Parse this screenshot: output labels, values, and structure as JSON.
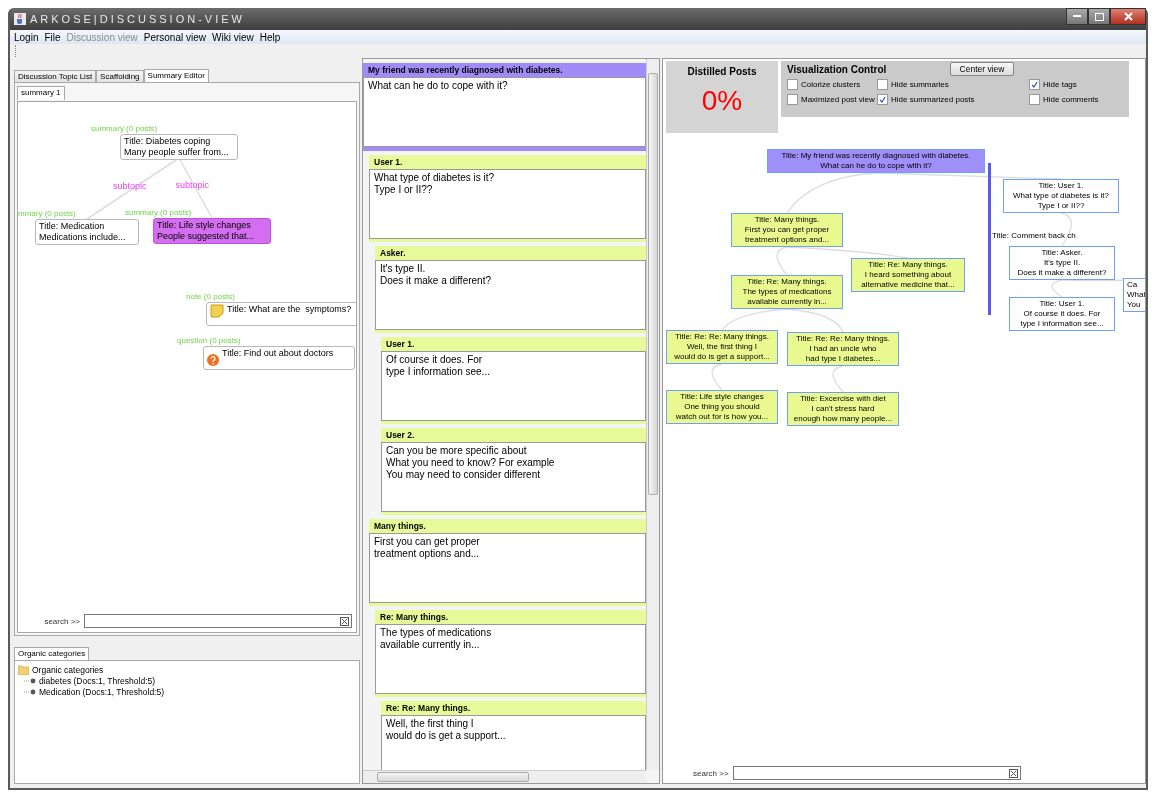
{
  "window": {
    "title": "ARKOSE|DISCUSSION-VIEW"
  },
  "menu": [
    {
      "label": "Login",
      "disabled": false
    },
    {
      "label": "File",
      "disabled": false
    },
    {
      "label": "Discussion view",
      "disabled": true
    },
    {
      "label": "Personal view",
      "disabled": false
    },
    {
      "label": "Wiki view",
      "disabled": false
    },
    {
      "label": "Help",
      "disabled": false
    }
  ],
  "left_tabs": [
    {
      "label": "Discussion Topic List",
      "selected": false
    },
    {
      "label": "Scaffolding",
      "selected": false
    },
    {
      "label": "Summary Editor",
      "selected": true
    }
  ],
  "summary_tabs": [
    {
      "label": "summary 1",
      "selected": true
    }
  ],
  "summary_map": {
    "nodes": [
      {
        "tag": "summary (0 posts)",
        "text": "Title: Diabetes coping\nMany people suffer from...",
        "selected": false,
        "children": [
          {
            "relation": "subtopic",
            "tag": "mmary (0 posts)",
            "text": "Title: Medication\nMedications include...",
            "selected": false
          },
          {
            "relation": "subtopic",
            "tag": "summary (0 posts)",
            "text": "Title: Life style changes\nPeople suggested that...",
            "selected": true
          }
        ]
      },
      {
        "kind": "note",
        "tag": "note (0 posts)",
        "text": "Title: What are the  symptoms?",
        "selected": false
      },
      {
        "kind": "question",
        "tag": "question (0 posts)",
        "text": "Title: Find out about doctors",
        "selected": false
      }
    ]
  },
  "summary_search": {
    "label": "search >>"
  },
  "categories": {
    "tab": "Organic categories",
    "root": "Organic categories",
    "children": [
      {
        "label": "diabetes (Docs:1, Threshold:5)"
      },
      {
        "label": "Medication (Docs:1, Threshold:5)"
      }
    ]
  },
  "thread": {
    "posts": [
      {
        "kind": "root",
        "title": "My friend was recently diagnosed with diabetes.",
        "body": "What can he do to cope with it?",
        "children": [
          {
            "kind": "reply",
            "title": "User 1.",
            "body": "What type of diabetes is it?\nType I or II??",
            "children": [
              {
                "kind": "reply",
                "title": "Asker.",
                "body": "It's type II.\nDoes it make a different?",
                "children": [
                  {
                    "kind": "reply",
                    "title": "User 1.",
                    "body": "Of course it does. For\ntype I information see..."
                  },
                  {
                    "kind": "reply",
                    "title": "User 2.",
                    "body": "Can you be more specific about\nWhat you need to know? For example\nYou may need to consider different"
                  }
                ]
              }
            ]
          },
          {
            "kind": "reply",
            "title": "Many things.",
            "body": "First you can get proper\ntreatment options and...",
            "children": [
              {
                "kind": "reply",
                "title": "Re: Many things.",
                "body": "The types of medications\navailable currently in...",
                "children": [
                  {
                    "kind": "reply",
                    "title": "Re: Re: Many things.",
                    "body": "Well, the first thing I\nwould do is get a support..."
                  }
                ]
              }
            ]
          }
        ]
      }
    ]
  },
  "distilled": {
    "title": "Distilled Posts",
    "value": "0%"
  },
  "viz_control": {
    "title": "Visualization Control",
    "button": "Center view",
    "options": [
      {
        "label": "Colorize clusters",
        "checked": false
      },
      {
        "label": "Hide summaries",
        "checked": false
      },
      {
        "label": "Hide tags",
        "checked": true
      },
      {
        "label": "Maximized post view",
        "checked": false
      },
      {
        "label": "Hide summarized posts",
        "checked": true
      },
      {
        "label": "Hide comments",
        "checked": false
      }
    ]
  },
  "graph": {
    "nodes": [
      {
        "text": "Title: My friend was recently diagnosed with diabetes.\nWhat can he do to cope with it?",
        "color": "#9f8ff8",
        "children": [
          {
            "text": "Title: Many things.\nFirst you can get proper\ntreatment options and...",
            "color": "#eaf98f",
            "children": [
              {
                "text": "Title: Re: Many things.\nThe types of medications\navailable currently in...",
                "color": "#eaf98f",
                "children": [
                  {
                    "text": "Title: Re: Re: Many things.\nWell, the first thing I\nwould do is get a support...",
                    "color": "#eaf98f",
                    "children": [
                      {
                        "text": "Title: Life style changes\nOne thing you should\nwatch out for is how you...",
                        "color": "#eaf98f"
                      }
                    ]
                  },
                  {
                    "text": "Title: Re: Re: Many things.\nI had an uncle who\nhad type I diabetes...",
                    "color": "#eaf98f",
                    "children": [
                      {
                        "text": "Title: Excercise with diet\nI can't stress hard\nenough how many people...",
                        "color": "#eaf98f"
                      }
                    ]
                  }
                ]
              },
              {
                "text": "Title: Re: Many things.\nI heard something about\nalternative medicine that...",
                "color": "#eaf98f"
              }
            ]
          },
          {
            "text": "Title: User 1.\nWhat type of diabetes is it?\nType I or II??",
            "color": "#ffffff",
            "children": [
              {
                "text": "Title: Asker.\nIt's type II.\nDoes it make a different?",
                "color": "#ffffff",
                "children": [
                  {
                    "text": "Title: User 1.\nOf course it does. For\ntype I information see...",
                    "color": "#ffffff"
                  },
                  {
                    "text": "Ca\nWhat\nYou",
                    "color": "#ffffff"
                  }
                ]
              }
            ]
          }
        ]
      }
    ],
    "comment_label": "Title:  Comment back ch"
  },
  "graph_search": {
    "label": "search >>"
  }
}
